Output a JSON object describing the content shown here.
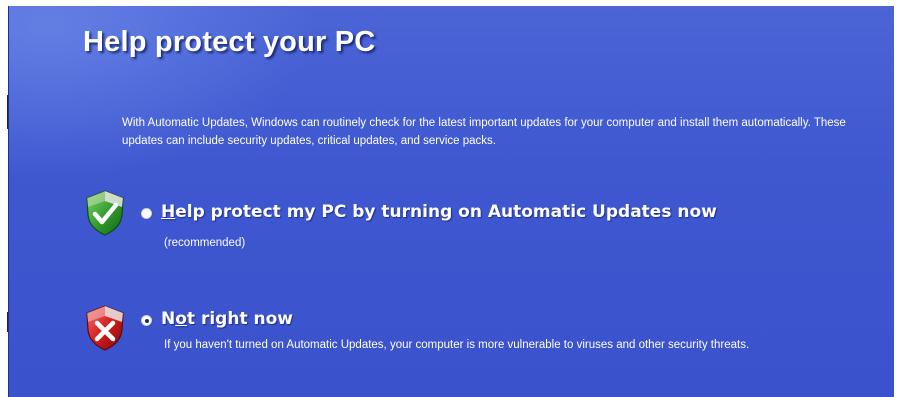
{
  "window": {
    "title": "Help protect your PC",
    "description": "With Automatic Updates, Windows can routinely check for the latest important updates for your computer and install them automatically. These updates can include security updates, critical updates, and service packs."
  },
  "colors": {
    "background": "#3f58d0",
    "text": "#ffffff",
    "shield_good": "#2f9a2a",
    "shield_bad": "#cc1a1a"
  },
  "options": [
    {
      "icon": "green-shield-check-icon",
      "label_accel": "H",
      "label_rest": "elp protect my PC by turning on Automatic Updates now",
      "sublabel": "(recommended)",
      "selected": false
    },
    {
      "icon": "red-shield-x-icon",
      "label_pre": "N",
      "label_accel": "o",
      "label_rest": "t right now",
      "sublabel": "If you haven't turned on Automatic Updates, your computer is more vulnerable to viruses and other security threats.",
      "selected": true
    }
  ]
}
